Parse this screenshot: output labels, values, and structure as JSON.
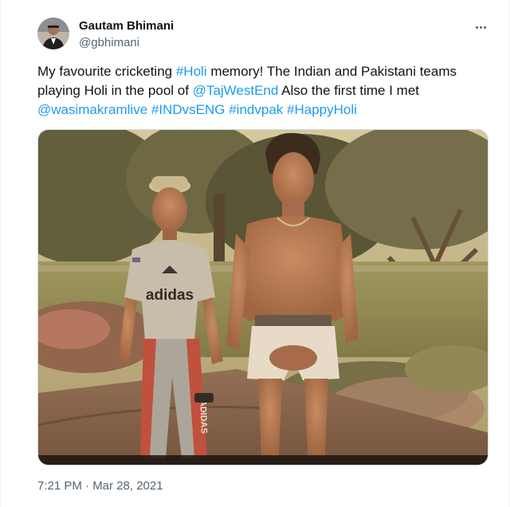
{
  "author": {
    "name": "Gautam Bhimani",
    "handle": "@gbhimani",
    "avatar_icon": "profile-avatar"
  },
  "more_icon": "more-horizontal-icon",
  "tweet": {
    "segments": [
      {
        "text": "My favourite cricketing ",
        "link": false
      },
      {
        "text": "#Holi",
        "link": true
      },
      {
        "text": " memory! The Indian and Pakistani teams playing Holi in the pool of ",
        "link": false
      },
      {
        "text": "@TajWestEnd",
        "link": true
      },
      {
        "text": " Also the first time I met ",
        "link": false
      },
      {
        "text": "@wasimakramlive",
        "link": true
      },
      {
        "text": " ",
        "link": false
      },
      {
        "text": "#INDvsENG",
        "link": true
      },
      {
        "text": " ",
        "link": false
      },
      {
        "text": "#indvpak",
        "link": true
      },
      {
        "text": " ",
        "link": false
      },
      {
        "text": "#HappyHoli",
        "link": true
      }
    ]
  },
  "media": {
    "shirt_text": "adidas",
    "pants_text": "ADIDAS"
  },
  "timestamp": "7:21 PM · Mar 28, 2021",
  "colors": {
    "link": "#1d9bf0",
    "secondary_text": "#536471",
    "primary_text": "#0f1419"
  }
}
